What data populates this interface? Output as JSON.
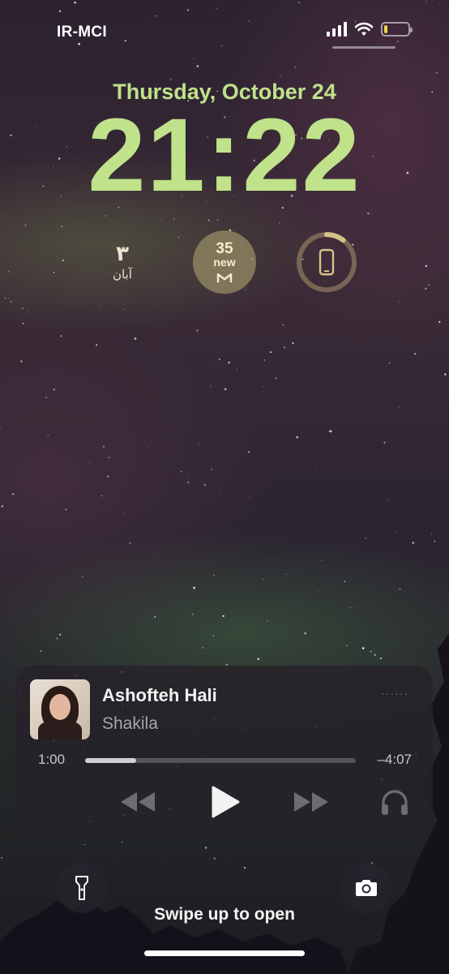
{
  "status_bar": {
    "carrier": "IR-MCI",
    "signal_icon": "cellular-signal-icon",
    "wifi_icon": "wifi-icon",
    "battery_icon": "battery-low-icon",
    "battery_color": "#f2d34a"
  },
  "lock_screen": {
    "date": "Thursday, October 24",
    "time": "21:22",
    "accent_color": "#bfe28a"
  },
  "widgets": {
    "calendar": {
      "day": "۳",
      "month": "آبان"
    },
    "mail": {
      "count": "35",
      "label": "new",
      "icon": "gmail-icon"
    },
    "battery": {
      "icon": "iphone-battery-icon"
    }
  },
  "now_playing": {
    "title": "Ashofteh Hali",
    "artist": "Shakila",
    "elapsed": "1:00",
    "remaining": "–4:07",
    "progress": 0.19,
    "controls": {
      "rewind_icon": "rewind-icon",
      "play_icon": "play-icon",
      "forward_icon": "fast-forward-icon",
      "output_icon": "headphones-icon"
    }
  },
  "bottom": {
    "flashlight_icon": "flashlight-icon",
    "camera_icon": "camera-icon",
    "swipe_text": "Swipe up to open"
  }
}
